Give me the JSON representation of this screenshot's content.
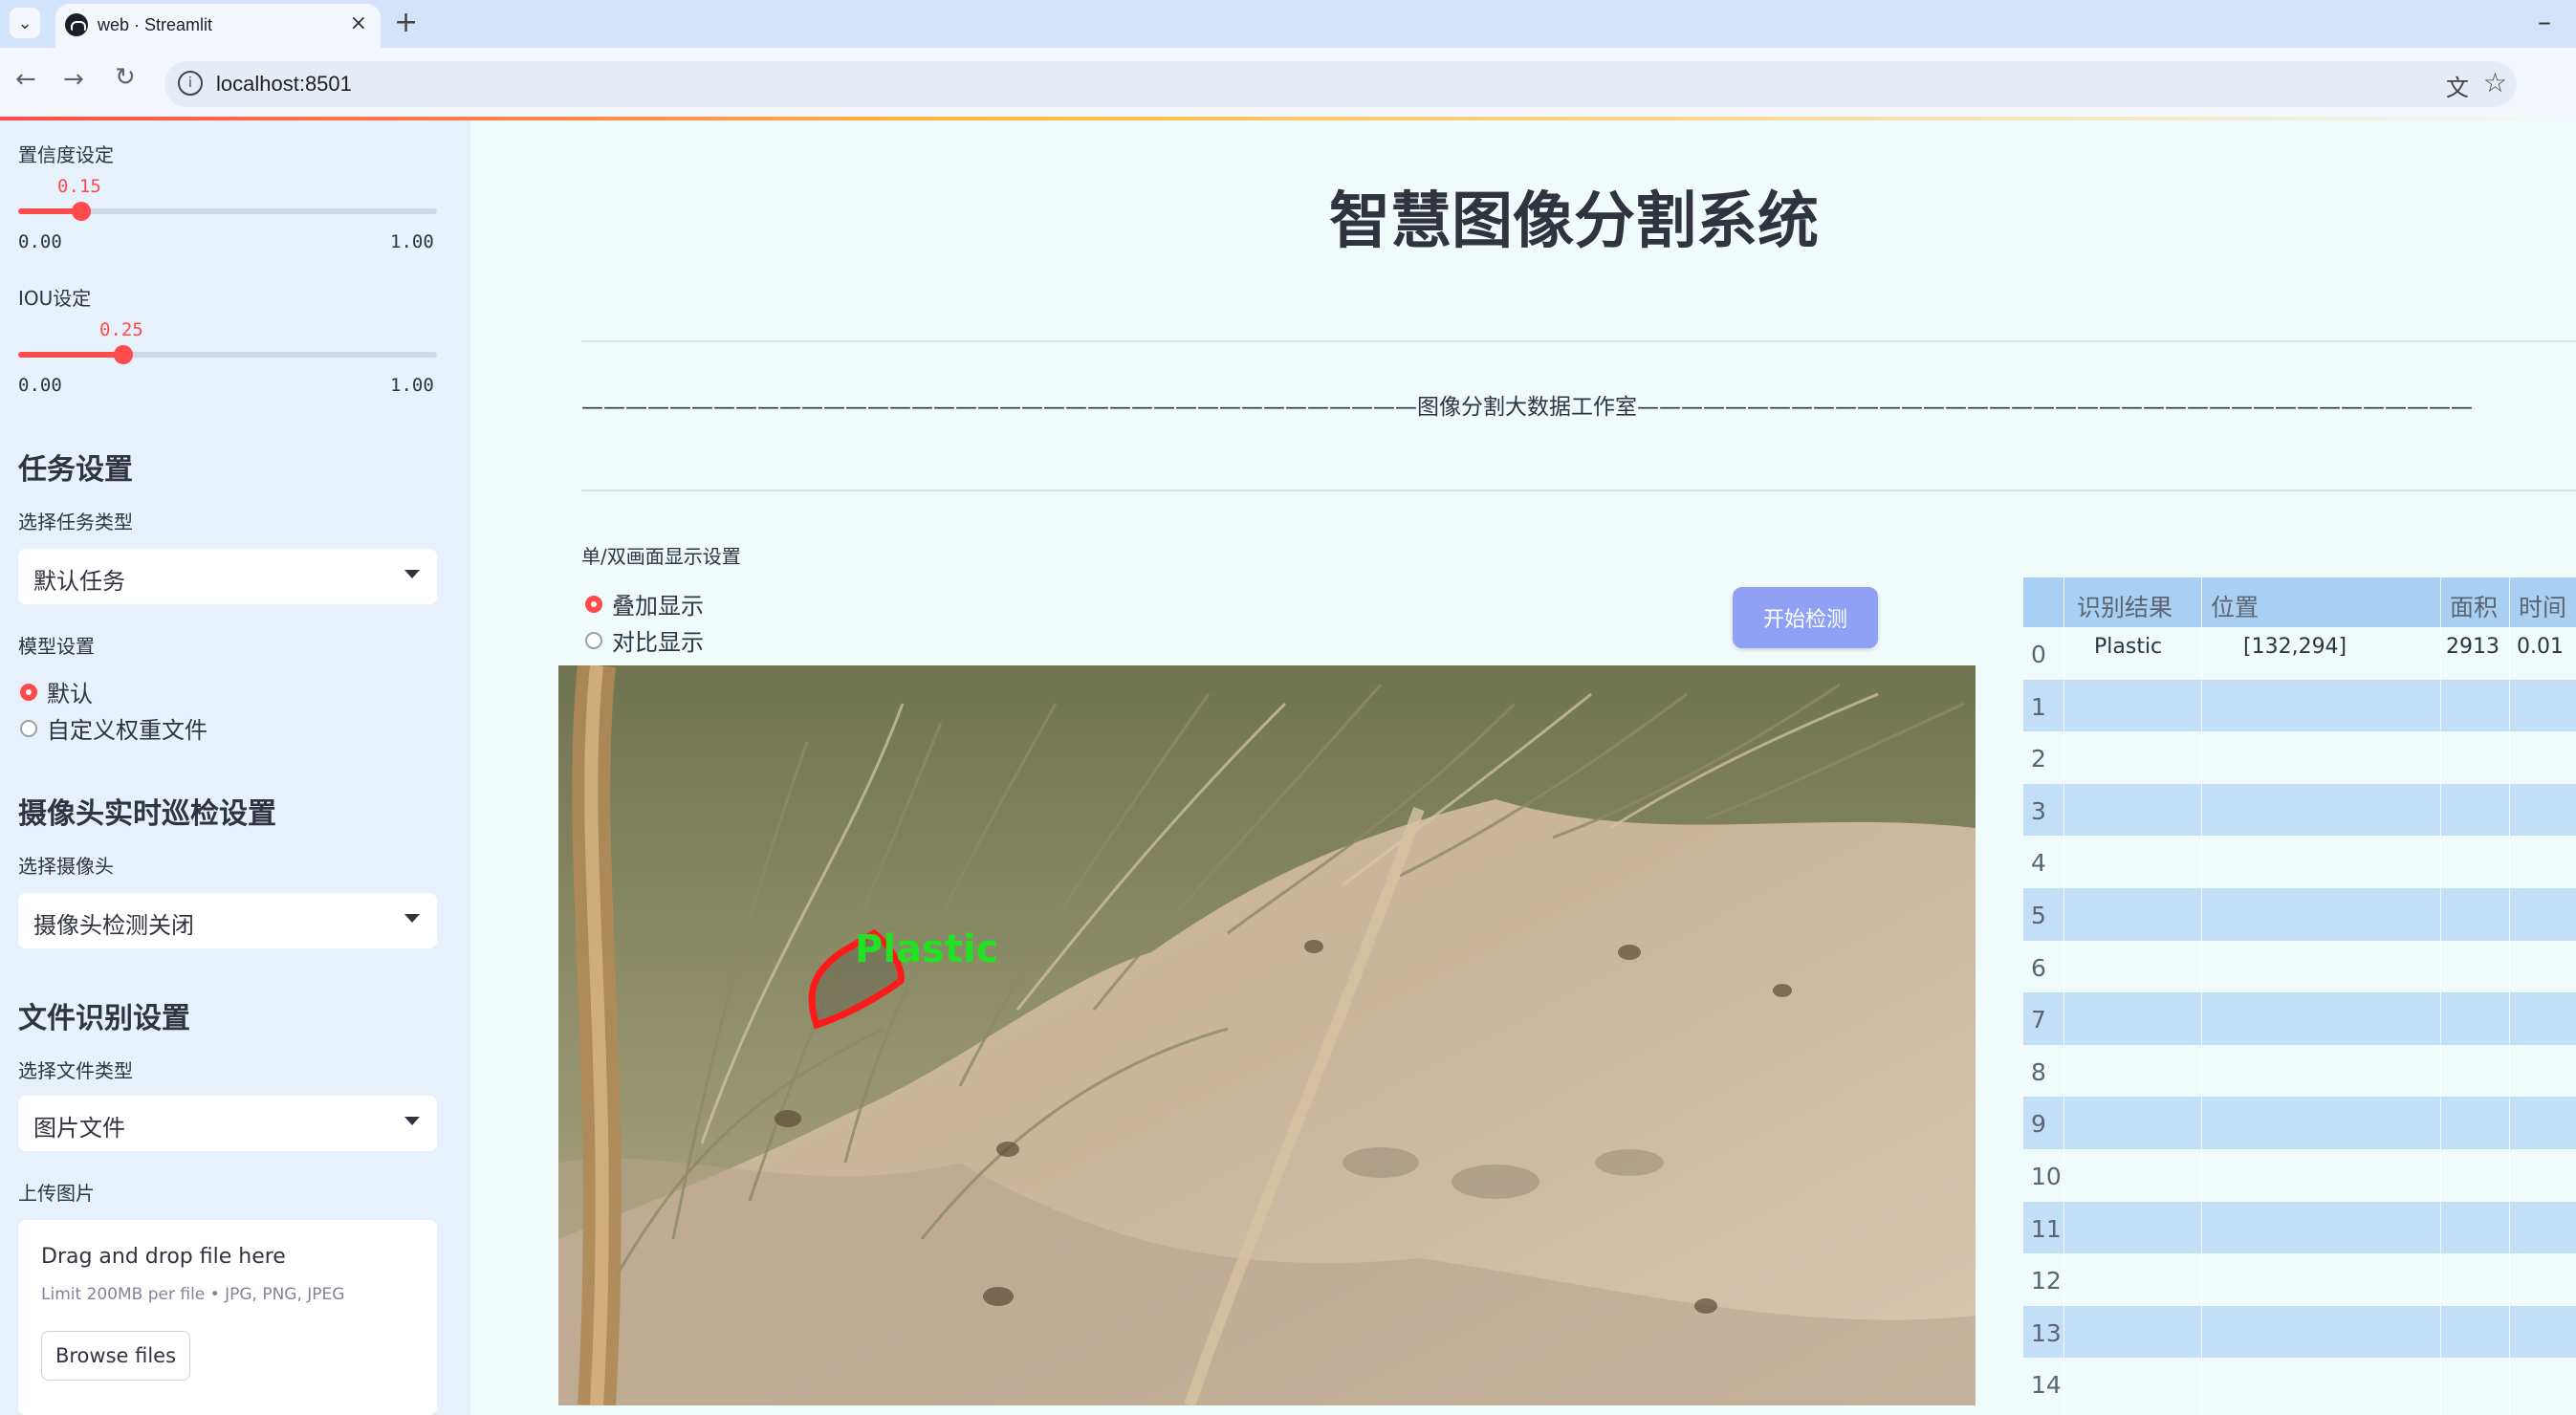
{
  "browser": {
    "tab_title": "web · Streamlit",
    "url": "localhost:8501"
  },
  "sidebar": {
    "confidence": {
      "label": "置信度设定",
      "value": "0.15",
      "min": "0.00",
      "max": "1.00",
      "fraction": 0.15
    },
    "iou": {
      "label": "IOU设定",
      "value": "0.25",
      "min": "0.00",
      "max": "1.00",
      "fraction": 0.25
    },
    "task_section": {
      "heading": "任务设置",
      "select_label": "选择任务类型",
      "selected": "默认任务"
    },
    "model_section": {
      "label": "模型设置",
      "options": [
        "默认",
        "自定义权重文件"
      ],
      "selected_index": 0
    },
    "camera_section": {
      "heading": "摄像头实时巡检设置",
      "select_label": "选择摄像头",
      "selected": "摄像头检测关闭"
    },
    "file_section": {
      "heading": "文件识别设置",
      "select_label": "选择文件类型",
      "selected": "图片文件"
    },
    "upload": {
      "label": "上传图片",
      "drop_text": "Drag and drop file here",
      "limit_text": "Limit 200MB per file • JPG, PNG, JPEG",
      "button": "Browse files"
    }
  },
  "main": {
    "title": "智慧图像分割系统",
    "subtitle": "——————————————————————————————————————图像分割大数据工作室——————————————————————————————————————",
    "display_label": "单/双画面显示设置",
    "display_options": [
      "叠加显示",
      "对比显示"
    ],
    "display_selected_index": 0,
    "start_button": "开始检测",
    "detection_label": "Plastic"
  },
  "results_table": {
    "columns": [
      "识别结果",
      "位置",
      "面积",
      "时间"
    ],
    "rows": [
      {
        "index": "0",
        "result": "Plastic",
        "position": "[132,294]",
        "area": "2913",
        "time": "0.01"
      },
      {
        "index": "1"
      },
      {
        "index": "2"
      },
      {
        "index": "3"
      },
      {
        "index": "4"
      },
      {
        "index": "5"
      },
      {
        "index": "6"
      },
      {
        "index": "7"
      },
      {
        "index": "8"
      },
      {
        "index": "9"
      },
      {
        "index": "10"
      },
      {
        "index": "11"
      },
      {
        "index": "12"
      },
      {
        "index": "13"
      },
      {
        "index": "14"
      }
    ]
  },
  "colors": {
    "accent": "#ff4b4b",
    "button": "#8fa0f5",
    "table_header": "#a9d0f2",
    "table_stripe": "#c2dff7"
  }
}
